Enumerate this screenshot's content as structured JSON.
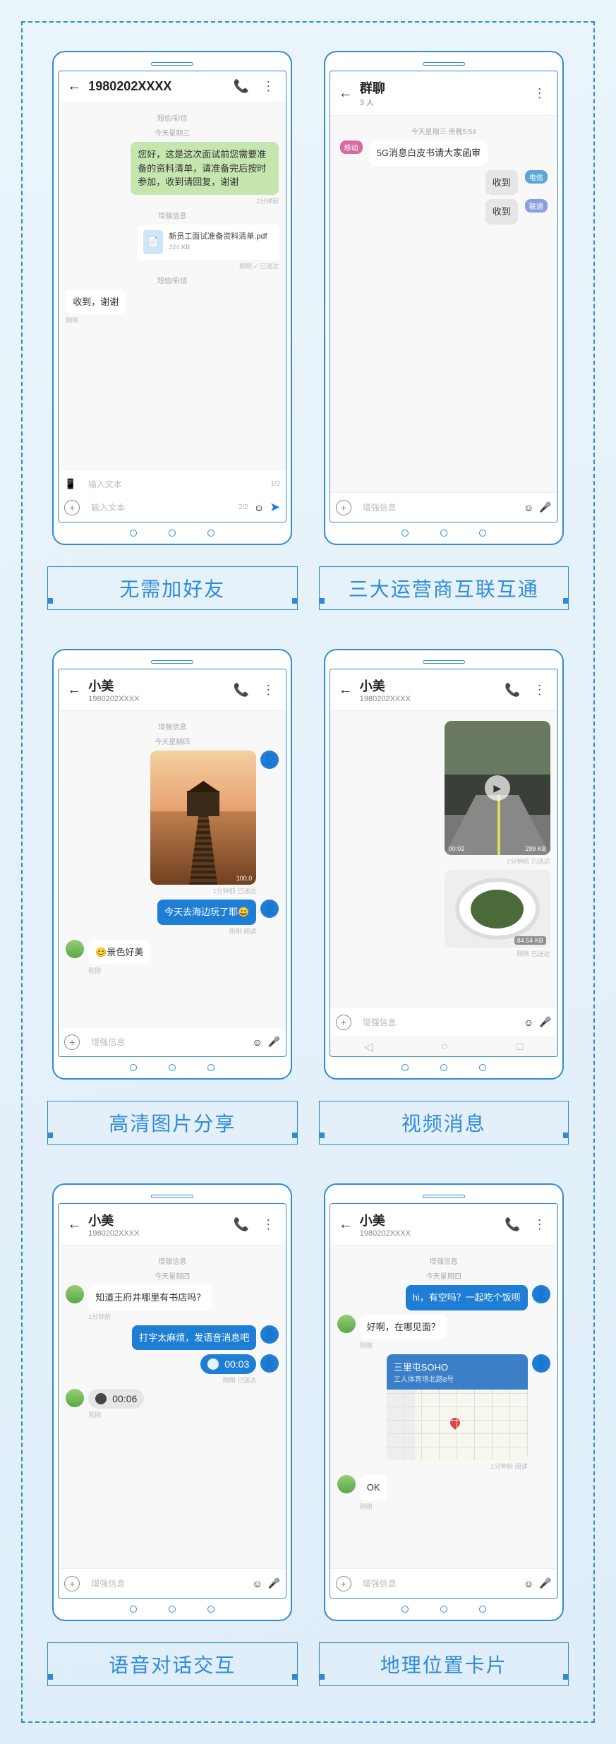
{
  "captions": {
    "p1": "无需加好友",
    "p2": "三大运营商互联互通",
    "p3": "高清图片分享",
    "p4": "视频消息",
    "p5": "语音对话交互",
    "p6": "地理位置卡片"
  },
  "phone1": {
    "title": "1980202XXXX",
    "sys1": "短信/彩信",
    "date": "今天星期三",
    "msg1": "您好，这是这次面试前您需要准备的资料清单，请准备完后按时参加，收到请回复，谢谢",
    "stamp1": "2分钟前",
    "sys2": "增强信息",
    "file_name": "新员工面试准备资料清单.pdf",
    "file_size": "324 KB",
    "stamp2": "刚刚  ✓ 已送达",
    "sys3": "短信/彩信",
    "reply": "收到，谢谢",
    "stamp3": "刚刚",
    "input_ph": "输入文本",
    "input_c1": "1/2",
    "input_c2": "2/2"
  },
  "phone2": {
    "title": "群聊",
    "sub": "3 人",
    "date": "今天星期三  傍晚5:54",
    "tag_mobile": "移动",
    "msg1": "5G消息白皮书请大家函审",
    "reply": "收到",
    "tag_tel": "电信",
    "tag_uni": "联通",
    "input_ph": "增强信息"
  },
  "phone3": {
    "title": "小美",
    "sub": "1980202XXXX",
    "sys1": "增强信息",
    "date": "今天星期四",
    "img_size": "100.0",
    "stamp1": "1分钟前 已送达",
    "msg_blue": "今天去海边玩了耶😄",
    "stamp2": "刚刚 阅读",
    "reply": "😊景色好美",
    "stamp3": "刚刚",
    "input_ph": "增强信息"
  },
  "phone4": {
    "title": "小美",
    "sub": "1980202XXXX",
    "vid_dur": "00:02",
    "vid_size": "299 KB",
    "stamp1": "2分钟前 已送达",
    "food_size": "84.54 KB",
    "stamp2": "刚刚 已送达",
    "input_ph": "增强信息"
  },
  "phone5": {
    "title": "小美",
    "sub": "1980202XXXX",
    "sys1": "增强信息",
    "date": "今天星期四",
    "msg1": "知道王府井哪里有书店吗？",
    "stamp1": "1分钟前",
    "msg2": "打字太麻烦，发语音消息吧",
    "voice_out": "00:03",
    "stamp2": "刚刚 已送达",
    "voice_in": "00:06",
    "stamp3": "刚刚",
    "input_ph": "增强信息"
  },
  "phone6": {
    "title": "小美",
    "sub": "1980202XXXX",
    "sys1": "增强信息",
    "date": "今天星期四",
    "msg1": "hi，有空吗？一起吃个饭呗",
    "reply1": "好啊，在哪见面？",
    "stamp_r1": "刚刚",
    "loc_title": "三里屯SOHO",
    "loc_sub": "工人体育场北路8号",
    "stamp_loc": "1分钟前 阅读",
    "reply2": "OK",
    "stamp_r2": "刚刚",
    "input_ph": "增强信息"
  }
}
